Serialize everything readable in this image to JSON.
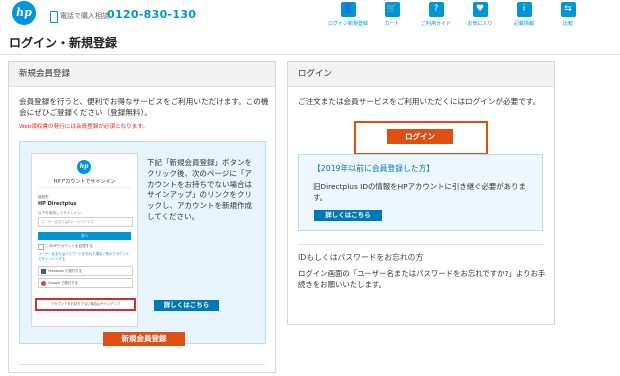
{
  "header": {
    "logo": "hp",
    "phone_label": "電話で購入相談",
    "phone_number": "0120-830-130",
    "nav": [
      {
        "label": "ログイン新規登録",
        "icon": "user-icon",
        "glyph": "👤"
      },
      {
        "label": "カート",
        "icon": "cart-icon",
        "glyph": "🛒"
      },
      {
        "label": "ご利用ガイド",
        "icon": "guide-icon",
        "glyph": "?"
      },
      {
        "label": "お気に入り",
        "icon": "heart-icon",
        "glyph": "♥"
      },
      {
        "label": "記載情報",
        "icon": "info-icon",
        "glyph": "i"
      },
      {
        "label": "比較",
        "icon": "compare-icon",
        "glyph": "⇆"
      }
    ]
  },
  "page_title": "ログイン・新規登録",
  "register": {
    "heading": "新規会員登録",
    "desc": "会員登録を行うと、便利でお得なサービスをご利用いただけます。この機会にぜひご登録ください（登録無料）。",
    "note": "Web領収書の発行には会員登録が必須となります。",
    "mock": {
      "logo": "hp",
      "title": "HPアカウントでサインイン",
      "app_label": "接続先",
      "app_name": "HP Directplus",
      "sub_label": "以下を使用してサインイン：",
      "input_placeholder": "ユーザー名またはEメールアドレス",
      "next": "次へ",
      "remember": "このHPアカウントを記憶する",
      "help": "ユーザー名またはパスワードを忘れた場合 / 別のアカウントでサインインする",
      "facebook": "Facebook で続行する",
      "google": "Google で続行する",
      "signup": "アカウントをお持ちでない場合はサインアップ"
    },
    "info_text": "下記「新規会員登録」ボタンをクリック後、次のページに「アカウントをお持ちでない場合はサインアップ」のリンクをクリックし、アカウントを新規作成してください。",
    "more_button": "詳しくはこちら",
    "register_button": "新規会員登録"
  },
  "login": {
    "heading": "ログイン",
    "desc": "ご注文または会員サービスをご利用いただくにはログインが必要です。",
    "login_button": "ログイン",
    "old_title": "【2019年以前に会員登録した方】",
    "old_text": "旧Directplus IDの情報をHPアカウントに引き継ぐ必要があります。",
    "more_button": "詳しくはこちら",
    "pw_title": "IDもしくはパスワードをお忘れの方",
    "pw_text": "ログイン画面の「ユーザー名またはパスワードをお忘れですか?」よりお手続きをお願いいたします。"
  }
}
